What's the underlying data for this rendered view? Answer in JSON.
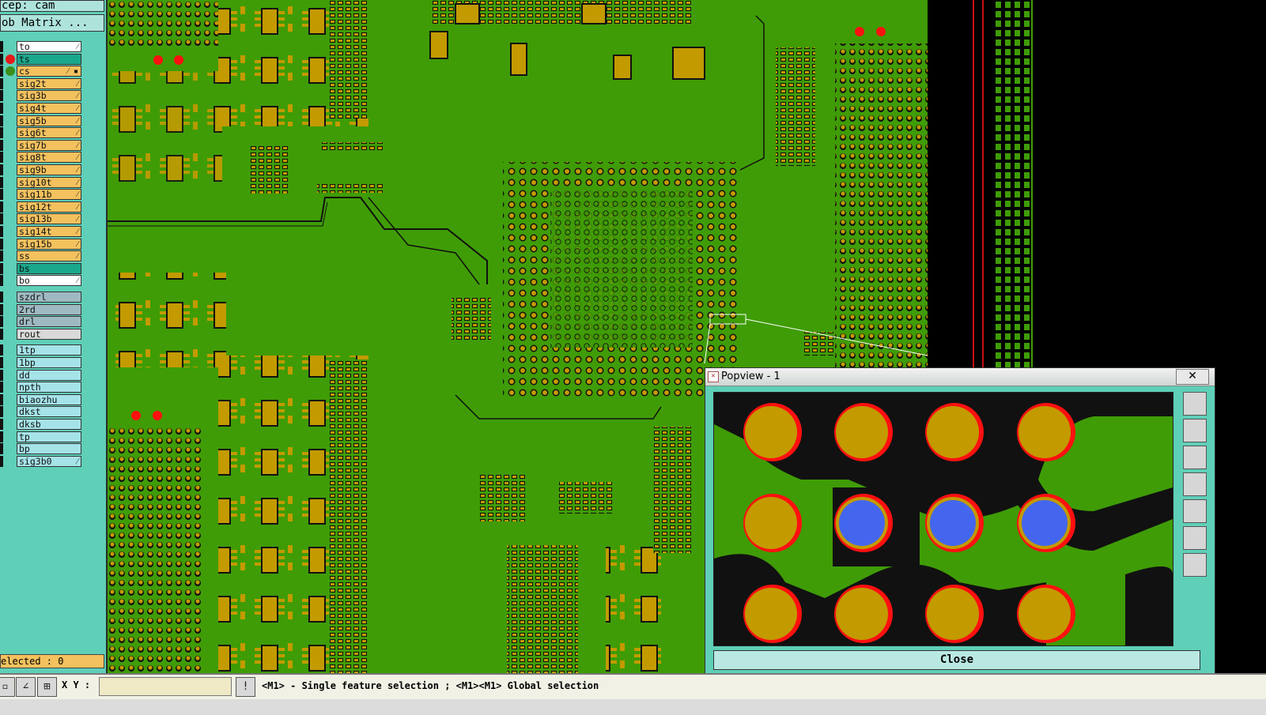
{
  "left_panel": {
    "step_label": "cep: cam",
    "matrix_button": "ob Matrix ...",
    "selected_count": "elected : 0",
    "layers": [
      {
        "name": "to",
        "color": "#ffffff",
        "dot": "",
        "mark": "⁄"
      },
      {
        "name": "ts",
        "color": "#1aa88c",
        "dot": "#e51a1a",
        "mark": ""
      },
      {
        "name": "cs",
        "color": "#f3c15e",
        "dot": "#3a8f1c",
        "mark": "⁄ ▪"
      },
      {
        "name": "sig2t",
        "color": "#f3c15e",
        "dot": "",
        "mark": "⁄"
      },
      {
        "name": "sig3b",
        "color": "#f3c15e",
        "dot": "",
        "mark": "⁄"
      },
      {
        "name": "sig4t",
        "color": "#f3c15e",
        "dot": "",
        "mark": "⁄"
      },
      {
        "name": "sig5b",
        "color": "#f3c15e",
        "dot": "",
        "mark": "⁄"
      },
      {
        "name": "sig6t",
        "color": "#f3c15e",
        "dot": "",
        "mark": "⁄"
      },
      {
        "name": "sig7b",
        "color": "#f3c15e",
        "dot": "",
        "mark": "⁄"
      },
      {
        "name": "sig8t",
        "color": "#f3c15e",
        "dot": "",
        "mark": "⁄"
      },
      {
        "name": "sig9b",
        "color": "#f3c15e",
        "dot": "",
        "mark": "⁄"
      },
      {
        "name": "sig10t",
        "color": "#f3c15e",
        "dot": "",
        "mark": "⁄"
      },
      {
        "name": "sig11b",
        "color": "#f3c15e",
        "dot": "",
        "mark": "⁄"
      },
      {
        "name": "sig12t",
        "color": "#f3c15e",
        "dot": "",
        "mark": "⁄"
      },
      {
        "name": "sig13b",
        "color": "#f3c15e",
        "dot": "",
        "mark": "⁄"
      },
      {
        "name": "sig14t",
        "color": "#f3c15e",
        "dot": "",
        "mark": "⁄"
      },
      {
        "name": "sig15b",
        "color": "#f3c15e",
        "dot": "",
        "mark": "⁄"
      },
      {
        "name": "ss",
        "color": "#f3c15e",
        "dot": "",
        "mark": "⁄"
      },
      {
        "name": "bs",
        "color": "#1aa88c",
        "dot": "",
        "mark": ""
      },
      {
        "name": "bo",
        "color": "#ffffff",
        "dot": "",
        "mark": "⁄"
      },
      {
        "name": "szdrl",
        "color": "#9fb9c2",
        "dot": "",
        "mark": ""
      },
      {
        "name": "2rd",
        "color": "#9fb9c2",
        "dot": "",
        "mark": ""
      },
      {
        "name": "drl",
        "color": "#9fb9c2",
        "dot": "",
        "mark": ""
      },
      {
        "name": "rout",
        "color": "#d9d9d9",
        "dot": "",
        "mark": ""
      },
      {
        "name": "1tp",
        "color": "#a5e3e8",
        "dot": "",
        "mark": ""
      },
      {
        "name": "1bp",
        "color": "#a5e3e8",
        "dot": "",
        "mark": ""
      },
      {
        "name": "dd",
        "color": "#a5e3e8",
        "dot": "",
        "mark": ""
      },
      {
        "name": "npth",
        "color": "#a5e3e8",
        "dot": "",
        "mark": ""
      },
      {
        "name": "biaozhu",
        "color": "#a5e3e8",
        "dot": "",
        "mark": ""
      },
      {
        "name": "dkst",
        "color": "#a5e3e8",
        "dot": "",
        "mark": ""
      },
      {
        "name": "dksb",
        "color": "#a5e3e8",
        "dot": "",
        "mark": ""
      },
      {
        "name": "tp",
        "color": "#a5e3e8",
        "dot": "",
        "mark": ""
      },
      {
        "name": "bp",
        "color": "#a5e3e8",
        "dot": "",
        "mark": ""
      },
      {
        "name": "sig3b0",
        "color": "#a5e3e8",
        "dot": "",
        "mark": "⁄"
      }
    ]
  },
  "status_bar": {
    "xy_label": "X Y :",
    "xy_value": "",
    "message": "<M1> - Single feature selection ; <M1><M1> Global selection"
  },
  "popview": {
    "title": "Popview - 1",
    "close_label": "Close",
    "close_x": "✕"
  },
  "colors": {
    "board_green": "#3f9c06",
    "pad_gold": "#c39a00",
    "via_blue": "#4466ee",
    "clearance_red": "#ff1010",
    "panel_teal": "#5fcfb8"
  }
}
